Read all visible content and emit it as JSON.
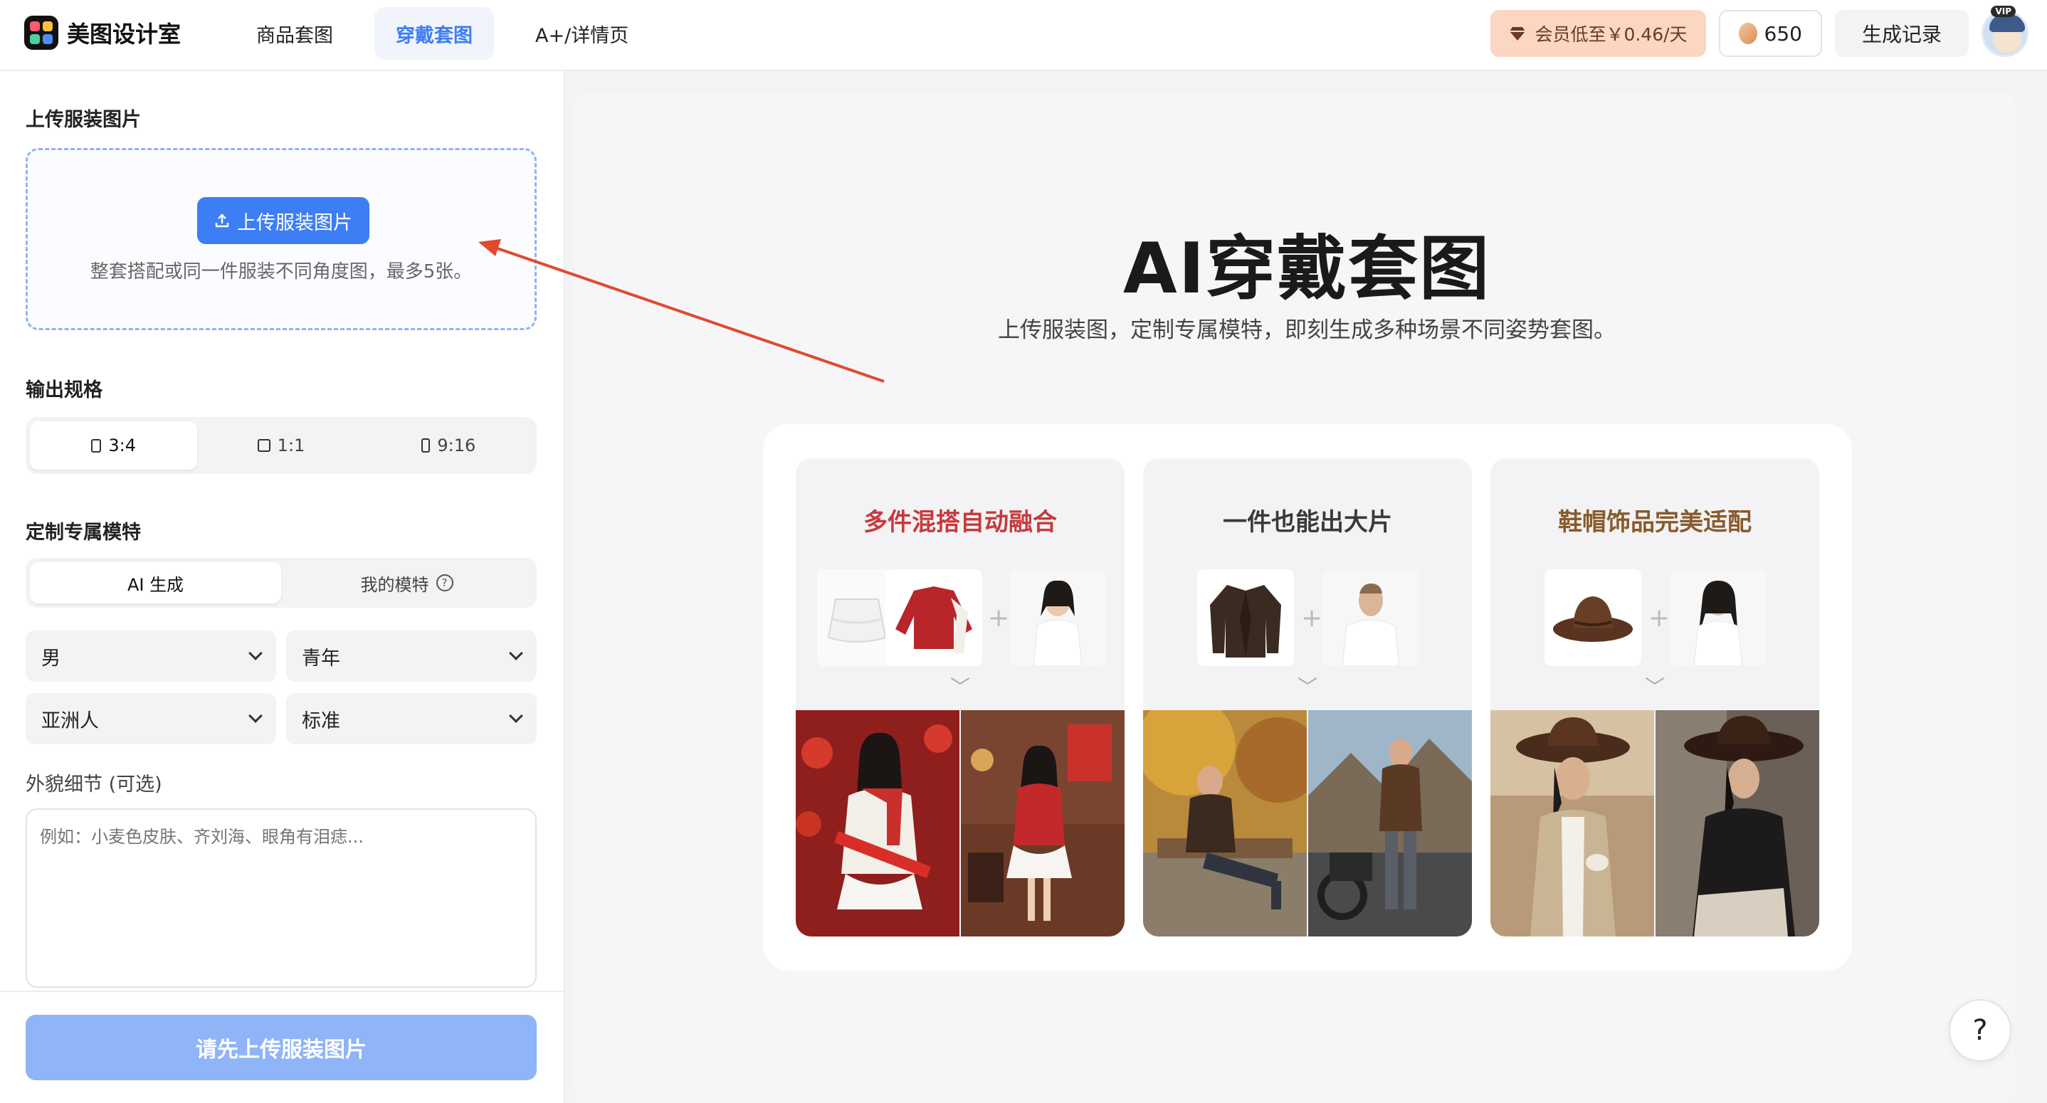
{
  "app": {
    "name": "美图设计室"
  },
  "nav": {
    "tabs": [
      {
        "label": "商品套图"
      },
      {
        "label": "穿戴套图",
        "active": true
      },
      {
        "label": "A+/详情页"
      }
    ]
  },
  "header": {
    "vip_label": "会员低至￥0.46/天",
    "coins": "650",
    "history_label": "生成记录",
    "avatar_badge": "VIP"
  },
  "left": {
    "upload": {
      "title": "上传服装图片",
      "button": "上传服装图片",
      "hint": "整套搭配或同一件服装不同角度图，最多5张。"
    },
    "output": {
      "title": "输出规格",
      "ratios": [
        {
          "label": "3:4",
          "active": true
        },
        {
          "label": "1:1"
        },
        {
          "label": "9:16"
        }
      ]
    },
    "model": {
      "title": "定制专属模特",
      "tabs": [
        {
          "label": "AI 生成",
          "active": true
        },
        {
          "label": "我的模特"
        }
      ],
      "selects": {
        "gender": "男",
        "age": "青年",
        "ethnicity": "亚洲人",
        "body": "标准"
      },
      "details_label": "外貌细节 (可选)",
      "details_placeholder": "例如：小麦色皮肤、齐刘海、眼角有泪痣..."
    },
    "submit_label": "请先上传服装图片"
  },
  "main": {
    "title": "AI穿戴套图",
    "subtitle": "上传服装图，定制专属模特，即刻生成多种场景不同姿势套图。",
    "cards": [
      {
        "title": "多件混搭自动融合",
        "title_color": "#c8393c"
      },
      {
        "title": "一件也能出大片",
        "title_color": "#3a3a3a"
      },
      {
        "title": "鞋帽饰品完美适配",
        "title_color": "#8a5a2b"
      }
    ],
    "down_glyph": "﹀",
    "plus_glyph": "+"
  },
  "help_label": "?",
  "colors": {
    "accent": "#3d7ef5",
    "annotation_arrow": "#e04a2f"
  }
}
